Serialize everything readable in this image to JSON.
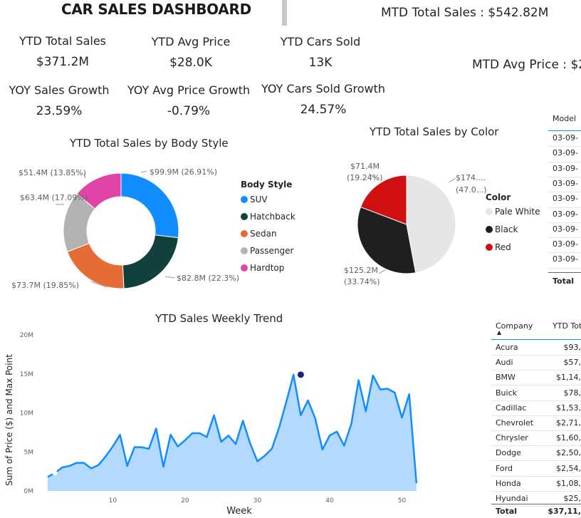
{
  "header": {
    "title": "CAR SALES DASHBOARD",
    "mtd_total_sales": "MTD Total Sales : $542.82M",
    "mtd_avg_price": "MTD Avg Price : $2"
  },
  "kpis": {
    "ytd_total_sales": {
      "label": "YTD Total Sales",
      "value": "$371.2M"
    },
    "ytd_avg_price": {
      "label": "YTD Avg Price",
      "value": "$28.0K"
    },
    "ytd_cars_sold": {
      "label": "YTD Cars Sold",
      "value": "13K"
    },
    "yoy_sales_growth": {
      "label": "YOY Sales Growth",
      "value": "23.59%"
    },
    "yoy_avg_price_growth": {
      "label": "YOY Avg Price Growth",
      "value": "-0.79%"
    },
    "yoy_cars_sold_growth": {
      "label": "YOY Cars Sold Growth",
      "value": "24.57%"
    }
  },
  "colors": {
    "suv": "#118dff",
    "hatchback": "#12403c",
    "sedan": "#e66c37",
    "passenger": "#b3b3b3",
    "hardtop": "#e044a7",
    "pale_white": "#e6e6e6",
    "black": "#1f1f1f",
    "red": "#d01010",
    "trend_line": "#118dff",
    "trend_fill": "#b3d9ff",
    "max_point": "#1a237e"
  },
  "chart_data": [
    {
      "type": "pie",
      "title": "YTD Total Sales by Body Style",
      "legend_title": "Body Style",
      "legend_position": "right",
      "donut": true,
      "labels": [
        "SUV",
        "Hatchback",
        "Sedan",
        "Passenger",
        "Hardtop"
      ],
      "values": [
        99.9,
        82.8,
        73.7,
        63.4,
        51.4
      ],
      "data_labels": [
        "$99.9M (26.91%)",
        "$82.8M (22.3%)",
        "$73.7M (19.85%)",
        "$63.4M (17.09%)",
        "$51.4M (13.85%)"
      ]
    },
    {
      "type": "pie",
      "title": "YTD Total Sales by Color",
      "legend_title": "Color",
      "legend_position": "right",
      "donut": false,
      "labels": [
        "Pale White",
        "Black",
        "Red"
      ],
      "values": [
        174.6,
        125.2,
        71.4
      ],
      "data_labels": [
        "$174....",
        "(47.0...)",
        "$125.2M",
        "(33.74%)",
        "$71.4M",
        "(19.24%)"
      ]
    },
    {
      "type": "area",
      "title": "YTD Sales Weekly Trend",
      "xlabel": "Week",
      "ylabel": "Sum of Price ($) and Max Point",
      "ylim": [
        0,
        20
      ],
      "y_ticks": [
        "0M",
        "5M",
        "10M",
        "15M",
        "20M"
      ],
      "x_ticks": [
        "10",
        "20",
        "30",
        "40",
        "50"
      ],
      "grid": false,
      "x": [
        1,
        2,
        3,
        4,
        5,
        6,
        7,
        8,
        9,
        10,
        11,
        12,
        13,
        14,
        15,
        16,
        17,
        18,
        19,
        20,
        21,
        22,
        23,
        24,
        25,
        26,
        27,
        28,
        29,
        30,
        31,
        32,
        33,
        34,
        35,
        36,
        37,
        38,
        39,
        40,
        41,
        42,
        43,
        44,
        45,
        46,
        47,
        48,
        49,
        50,
        51,
        52,
        53
      ],
      "values": [
        1.8,
        2.3,
        3.0,
        3.2,
        3.6,
        3.6,
        2.9,
        3.3,
        4.4,
        5.7,
        7.2,
        3.2,
        5.6,
        5.6,
        5.4,
        8.0,
        3.1,
        7.2,
        5.7,
        6.5,
        7.4,
        7.4,
        6.9,
        9.7,
        6.3,
        7.1,
        6.0,
        9.0,
        6.1,
        3.8,
        4.5,
        5.4,
        8.1,
        11.4,
        14.9,
        9.7,
        11.6,
        9.3,
        5.3,
        7.1,
        7.6,
        5.8,
        8.6,
        14.2,
        10.2,
        14.8,
        13.0,
        13.1,
        12.6,
        9.4,
        12.4,
        1.0
      ],
      "max_point": {
        "week": 36,
        "value": 14.9
      }
    }
  ],
  "model_table": {
    "header": "Model",
    "rows": [
      "03-09-",
      "03-09-",
      "03-09-",
      "03-09-",
      "03-09-",
      "03-09-",
      "03-09-",
      "03-09-",
      "03-09-"
    ],
    "total": "Total"
  },
  "company_table": {
    "headers": [
      "Company",
      "YTD Tot"
    ],
    "rows": [
      [
        "Acura",
        "$93,"
      ],
      [
        "Audi",
        "$57,"
      ],
      [
        "BMW",
        "$1,14,"
      ],
      [
        "Buick",
        "$78,"
      ],
      [
        "Cadillac",
        "$1,53,"
      ],
      [
        "Chevrolet",
        "$2,71,"
      ],
      [
        "Chrysler",
        "$1,60,"
      ],
      [
        "Dodge",
        "$2,50,"
      ],
      [
        "Ford",
        "$2,54,"
      ],
      [
        "Honda",
        "$1,08,"
      ],
      [
        "Hyundai",
        "$25,"
      ]
    ],
    "total": [
      "Total",
      "$37,11,"
    ]
  }
}
